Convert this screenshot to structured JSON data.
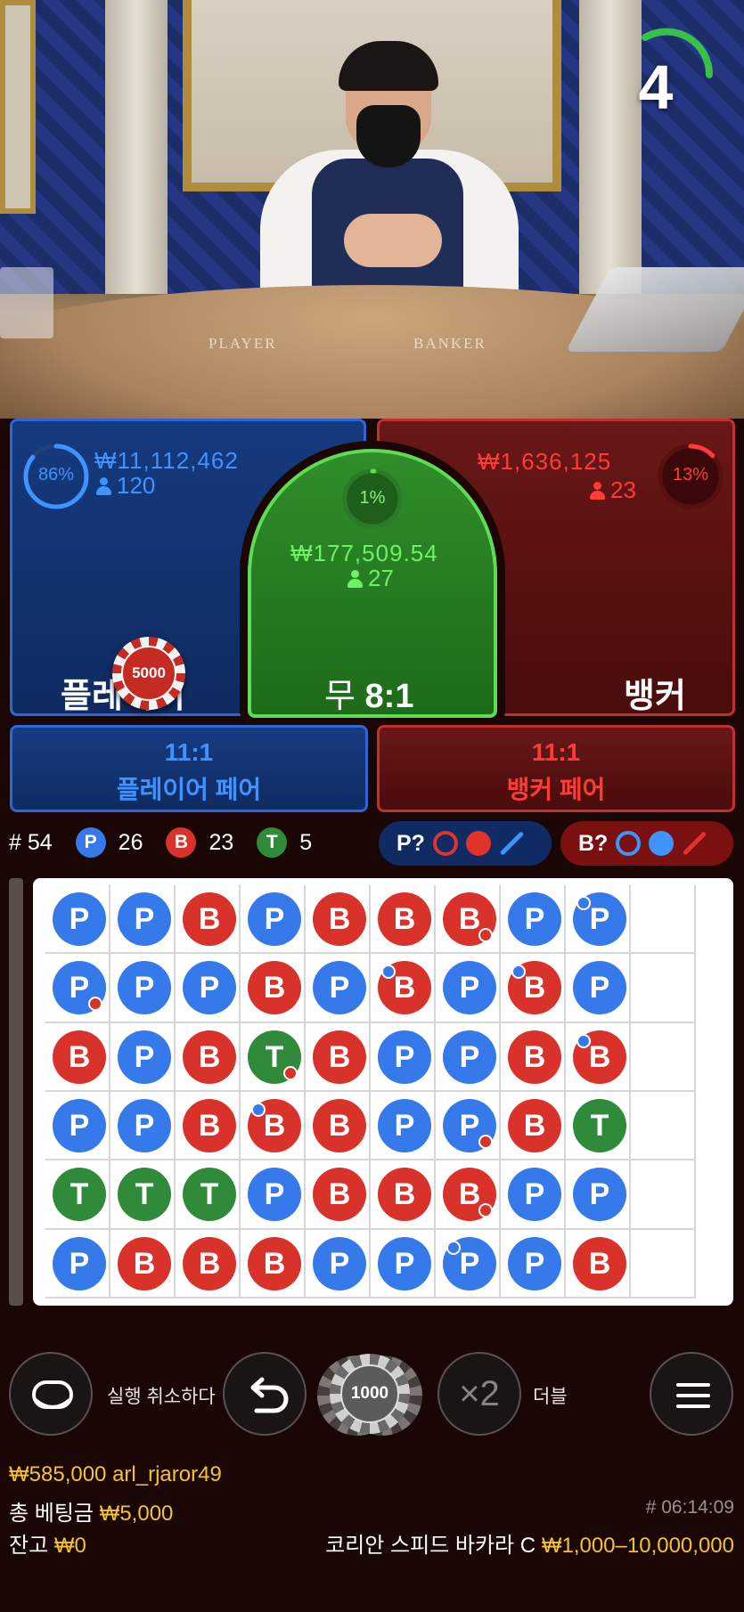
{
  "countdown": {
    "value": "4"
  },
  "table_words": {
    "player": "PLAYER",
    "banker": "BANKER"
  },
  "player": {
    "percent": "86%",
    "percent_value": 0.86,
    "amount": "₩11,112,462",
    "players": "120",
    "title": "플레이어"
  },
  "tie": {
    "percent": "1%",
    "percent_value": 0.01,
    "amount": "₩177,509.54",
    "players": "27",
    "title_main": "무",
    "title_odds": "8:1"
  },
  "banker": {
    "percent": "13%",
    "percent_value": 0.13,
    "amount": "₩1,636,125",
    "players": "23",
    "title": "뱅커"
  },
  "placed_chip": {
    "value": "5000"
  },
  "player_pair": {
    "odds": "11:1",
    "label": "플레이어 페어"
  },
  "banker_pair": {
    "odds": "11:1",
    "label": "뱅커 페어"
  },
  "stats": {
    "round_label": "# 54",
    "p_letter": "P",
    "p_count": "26",
    "b_letter": "B",
    "b_count": "23",
    "t_letter": "T",
    "t_count": "5"
  },
  "predict": {
    "player_label": "P?",
    "banker_label": "B?"
  },
  "bead_road": {
    "columns": 10,
    "rows": 6,
    "cells": [
      [
        {
          "r": "P"
        },
        {
          "r": "P"
        },
        {
          "r": "B"
        },
        {
          "r": "P"
        },
        {
          "r": "B"
        },
        {
          "r": "B"
        },
        {
          "r": "B",
          "br": true
        },
        {
          "r": "P"
        },
        {
          "r": "P",
          "tl": true
        },
        null
      ],
      [
        {
          "r": "P",
          "br": true
        },
        {
          "r": "P"
        },
        {
          "r": "P"
        },
        {
          "r": "B"
        },
        {
          "r": "P"
        },
        {
          "r": "B",
          "tl": true
        },
        {
          "r": "P"
        },
        {
          "r": "B",
          "tl": true
        },
        {
          "r": "P"
        },
        null
      ],
      [
        {
          "r": "B"
        },
        {
          "r": "P"
        },
        {
          "r": "B"
        },
        {
          "r": "T",
          "br": true
        },
        {
          "r": "B"
        },
        {
          "r": "P"
        },
        {
          "r": "P"
        },
        {
          "r": "B"
        },
        {
          "r": "B",
          "tl": true
        },
        null
      ],
      [
        {
          "r": "P"
        },
        {
          "r": "P"
        },
        {
          "r": "B"
        },
        {
          "r": "B",
          "tl": true
        },
        {
          "r": "B"
        },
        {
          "r": "P"
        },
        {
          "r": "P",
          "br": true
        },
        {
          "r": "B"
        },
        {
          "r": "T"
        },
        null
      ],
      [
        {
          "r": "T"
        },
        {
          "r": "T"
        },
        {
          "r": "T"
        },
        {
          "r": "P"
        },
        {
          "r": "B"
        },
        {
          "r": "B"
        },
        {
          "r": "B",
          "br": true
        },
        {
          "r": "P"
        },
        {
          "r": "P"
        },
        null
      ],
      [
        {
          "r": "P"
        },
        {
          "r": "B"
        },
        {
          "r": "B"
        },
        {
          "r": "B"
        },
        {
          "r": "P"
        },
        {
          "r": "P"
        },
        {
          "r": "P",
          "tl": true
        },
        {
          "r": "P"
        },
        {
          "r": "B"
        },
        null
      ]
    ]
  },
  "controls": {
    "undo_label": "실행 취소하다",
    "chip_value": "1000",
    "double_symbol": "×2",
    "double_label": "더블"
  },
  "footer": {
    "win_amount": "₩585,000",
    "username": "arl_rjaror49",
    "total_bet_label": "총 베팅금",
    "total_bet_value": "₩5,000",
    "balance_label": "잔고",
    "balance_value": "₩0",
    "game_id": "# 06:14:09",
    "table_name": "코리안 스피드 바카라 C",
    "limits": "₩1,000–10,000,000"
  },
  "colors": {
    "player_blue": "#3f93ff",
    "banker_red": "#ff3b36",
    "tie_green": "#5fdc55",
    "gold": "#f5c330"
  }
}
